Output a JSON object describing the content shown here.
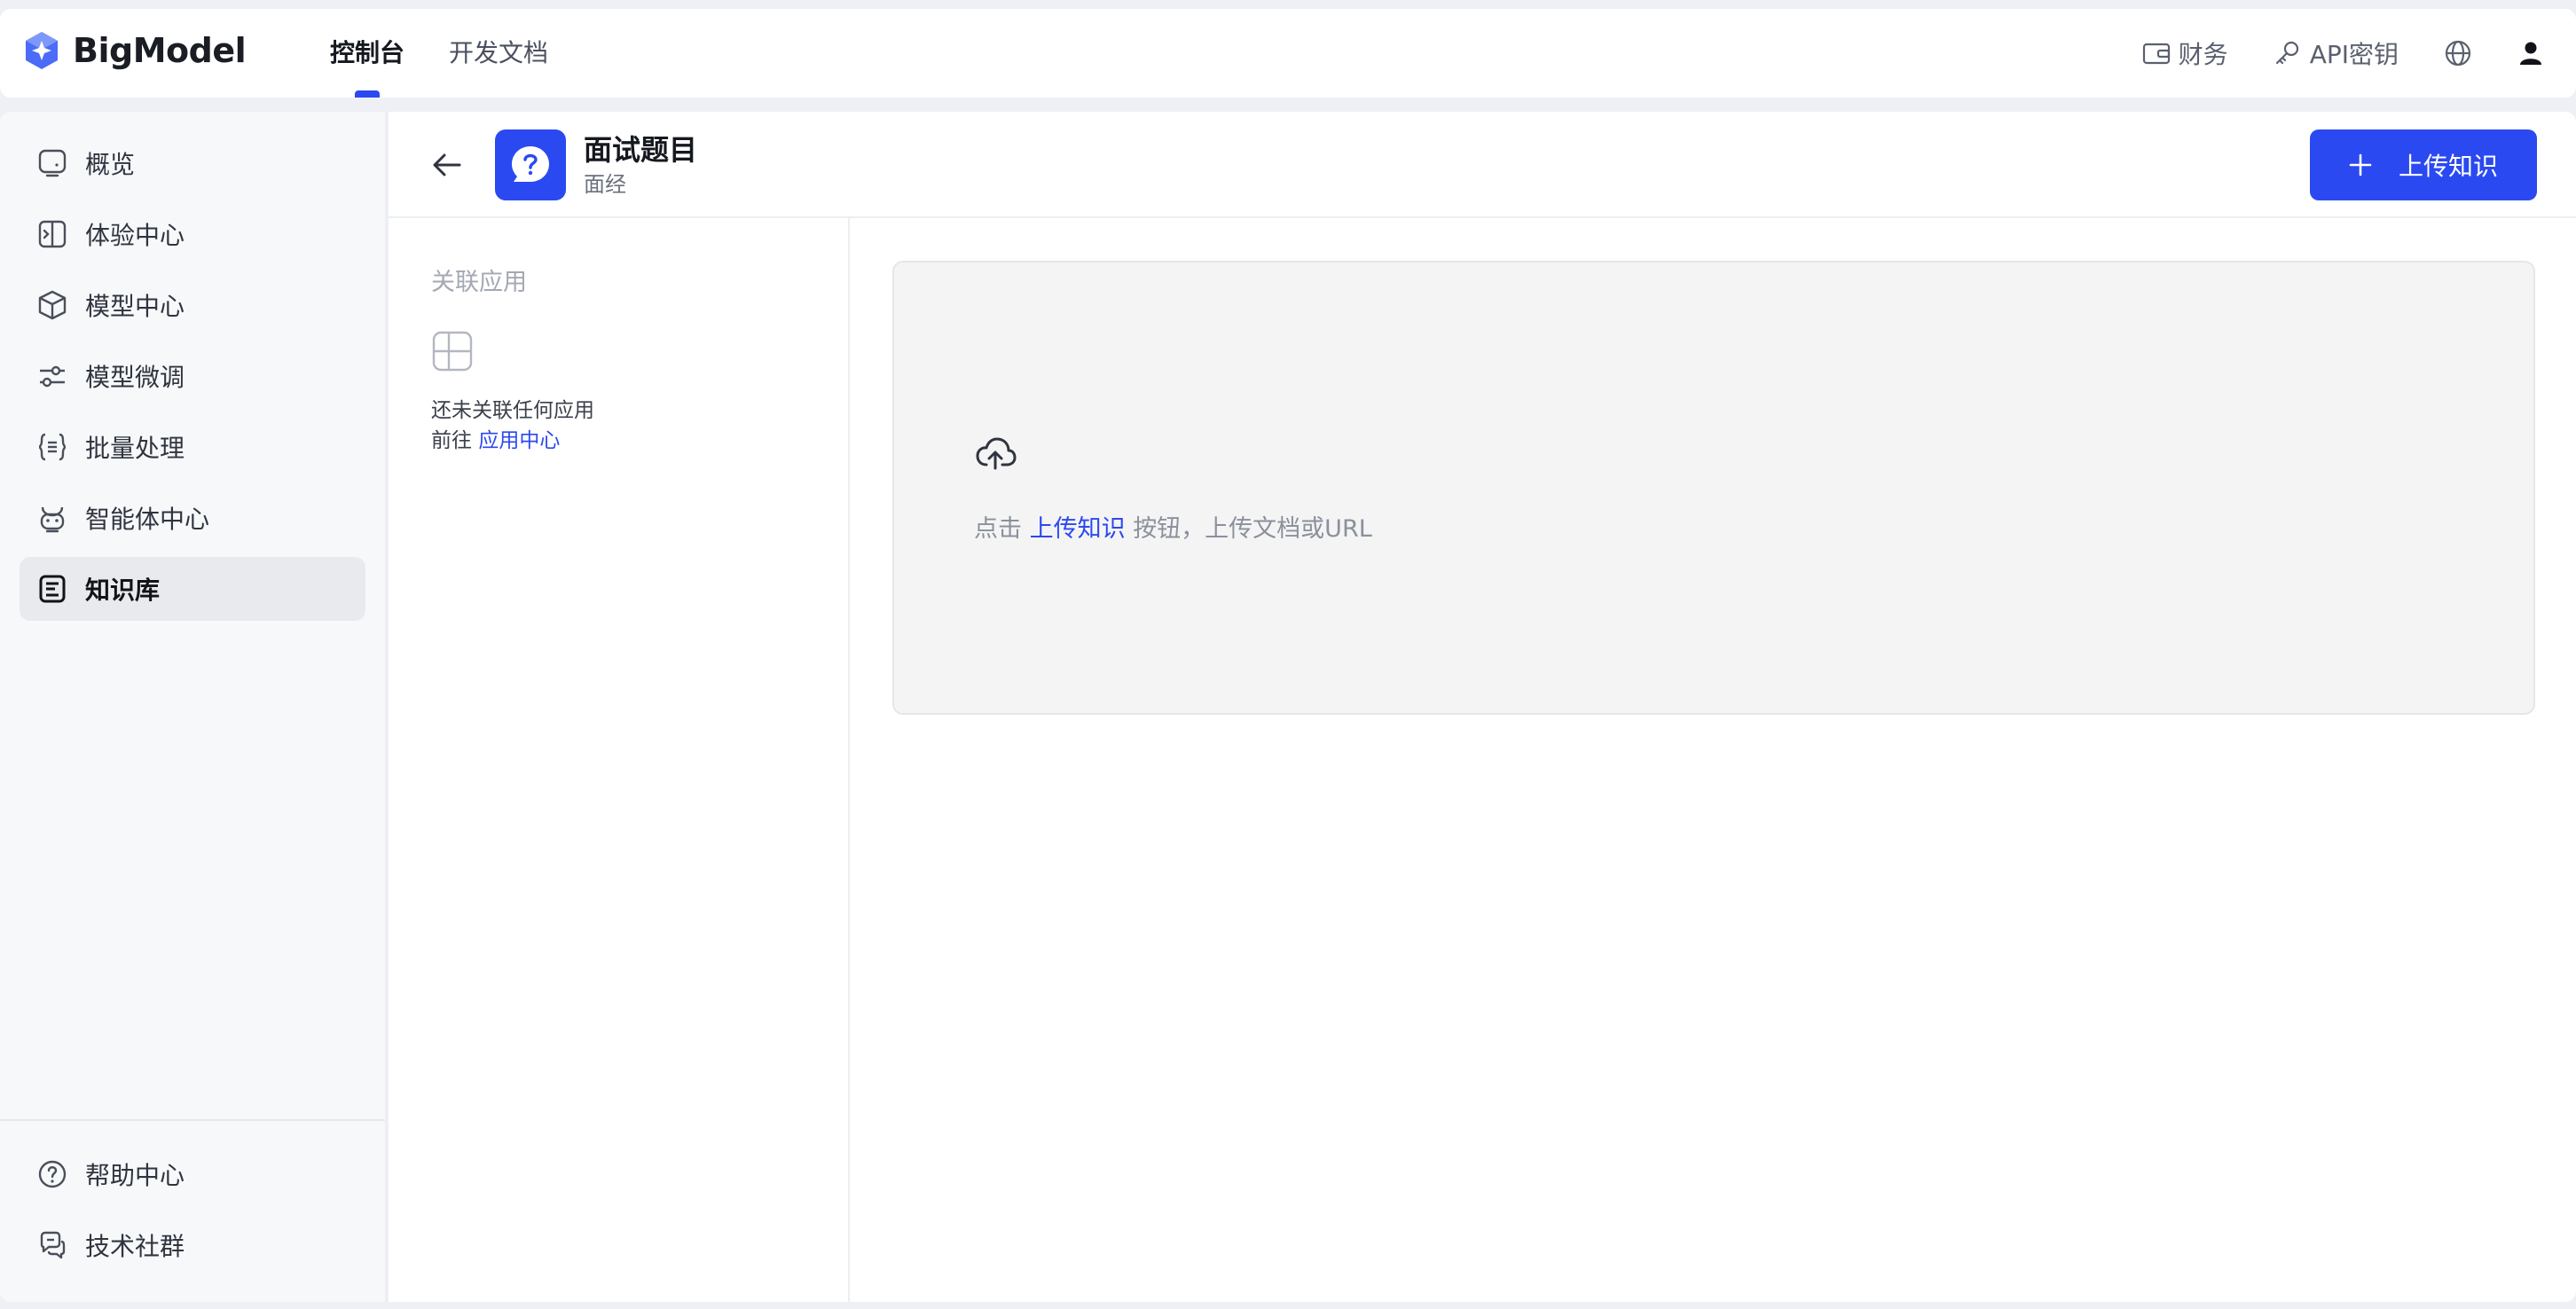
{
  "header": {
    "brand": "BigModel",
    "tabs": [
      {
        "label": "控制台",
        "active": true
      },
      {
        "label": "开发文档",
        "active": false
      }
    ],
    "right": {
      "finance": "财务",
      "api_key": "API密钥"
    }
  },
  "sidebar": {
    "items": [
      {
        "label": "概览",
        "icon": "overview-icon"
      },
      {
        "label": "体验中心",
        "icon": "experience-icon"
      },
      {
        "label": "模型中心",
        "icon": "cube-icon"
      },
      {
        "label": "模型微调",
        "icon": "sliders-icon"
      },
      {
        "label": "批量处理",
        "icon": "braces-icon"
      },
      {
        "label": "智能体中心",
        "icon": "robot-icon"
      },
      {
        "label": "知识库",
        "icon": "knowledge-icon",
        "active": true
      }
    ],
    "bottom": [
      {
        "label": "帮助中心",
        "icon": "help-icon"
      },
      {
        "label": "技术社群",
        "icon": "chat-icon"
      }
    ]
  },
  "knowledge_base": {
    "title": "面试题目",
    "subtitle": "面经",
    "upload_button": "上传知识"
  },
  "linked_apps": {
    "title": "关联应用",
    "empty_text": "还未关联任何应用",
    "goto_prefix": "前往",
    "goto_link": "应用中心"
  },
  "drop_zone": {
    "prefix": "点击",
    "link": "上传知识",
    "suffix": "按钮，上传文档或URL"
  },
  "colors": {
    "accent": "#2b49f0",
    "sidebar_bg": "#f7f8fa",
    "drop_bg": "#f4f4f5"
  }
}
